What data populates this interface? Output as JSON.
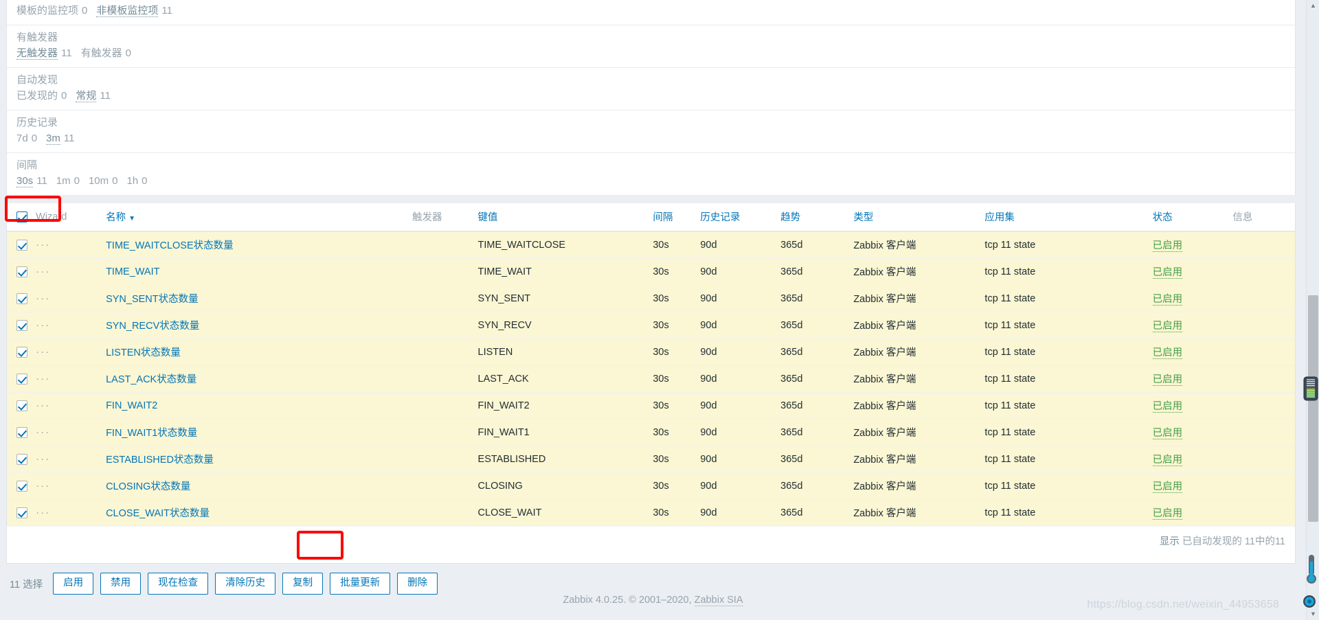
{
  "summary": [
    {
      "name": "template-items",
      "title": null,
      "values": [
        {
          "label": "模板的监控项",
          "count": "0",
          "link": false
        },
        {
          "label": "非模板监控项",
          "count": "11",
          "link": true
        }
      ]
    },
    {
      "name": "triggers",
      "title": "有触发器",
      "values": [
        {
          "label": "无触发器",
          "count": "11",
          "link": true
        },
        {
          "label": "有触发器",
          "count": "0",
          "link": false
        }
      ]
    },
    {
      "name": "discovery",
      "title": "自动发现",
      "values": [
        {
          "label": "已发现的",
          "count": "0",
          "link": false
        },
        {
          "label": "常规",
          "count": "11",
          "link": true
        }
      ]
    },
    {
      "name": "history",
      "title": "历史记录",
      "values": [
        {
          "label": "7d",
          "count": "0",
          "link": false
        },
        {
          "label": "3m",
          "count": "11",
          "link": true
        }
      ]
    },
    {
      "name": "interval",
      "title": "间隔",
      "values": [
        {
          "label": "30s",
          "count": "11",
          "link": true
        },
        {
          "label": "1m",
          "count": "0",
          "link": false
        },
        {
          "label": "10m",
          "count": "0",
          "link": false
        },
        {
          "label": "1h",
          "count": "0",
          "link": false
        }
      ]
    }
  ],
  "table": {
    "headers": {
      "wizard": "Wizard",
      "name": "名称",
      "sort_indicator": "▼",
      "triggers": "触发器",
      "key": "键值",
      "interval": "间隔",
      "history": "历史记录",
      "trends": "趋势",
      "type": "类型",
      "applications": "应用集",
      "status": "状态",
      "info": "信息"
    },
    "row_menu_icon": "···",
    "rows": [
      {
        "name": "TIME_WAITCLOSE状态数量",
        "triggers": "",
        "key": "TIME_WAITCLOSE",
        "interval": "30s",
        "history": "90d",
        "trends": "365d",
        "type": "Zabbix 客户端",
        "applications": "tcp 11 state",
        "status": "已启用",
        "info": ""
      },
      {
        "name": "TIME_WAIT",
        "triggers": "",
        "key": "TIME_WAIT",
        "interval": "30s",
        "history": "90d",
        "trends": "365d",
        "type": "Zabbix 客户端",
        "applications": "tcp 11 state",
        "status": "已启用",
        "info": ""
      },
      {
        "name": "SYN_SENT状态数量",
        "triggers": "",
        "key": "SYN_SENT",
        "interval": "30s",
        "history": "90d",
        "trends": "365d",
        "type": "Zabbix 客户端",
        "applications": "tcp 11 state",
        "status": "已启用",
        "info": ""
      },
      {
        "name": "SYN_RECV状态数量",
        "triggers": "",
        "key": "SYN_RECV",
        "interval": "30s",
        "history": "90d",
        "trends": "365d",
        "type": "Zabbix 客户端",
        "applications": "tcp 11 state",
        "status": "已启用",
        "info": ""
      },
      {
        "name": "LISTEN状态数量",
        "triggers": "",
        "key": "LISTEN",
        "interval": "30s",
        "history": "90d",
        "trends": "365d",
        "type": "Zabbix 客户端",
        "applications": "tcp 11 state",
        "status": "已启用",
        "info": ""
      },
      {
        "name": "LAST_ACK状态数量",
        "triggers": "",
        "key": "LAST_ACK",
        "interval": "30s",
        "history": "90d",
        "trends": "365d",
        "type": "Zabbix 客户端",
        "applications": "tcp 11 state",
        "status": "已启用",
        "info": ""
      },
      {
        "name": "FIN_WAIT2",
        "triggers": "",
        "key": "FIN_WAIT2",
        "interval": "30s",
        "history": "90d",
        "trends": "365d",
        "type": "Zabbix 客户端",
        "applications": "tcp 11 state",
        "status": "已启用",
        "info": ""
      },
      {
        "name": "FIN_WAIT1状态数量",
        "triggers": "",
        "key": "FIN_WAIT1",
        "interval": "30s",
        "history": "90d",
        "trends": "365d",
        "type": "Zabbix 客户端",
        "applications": "tcp 11 state",
        "status": "已启用",
        "info": ""
      },
      {
        "name": "ESTABLISHED状态数量",
        "triggers": "",
        "key": "ESTABLISHED",
        "interval": "30s",
        "history": "90d",
        "trends": "365d",
        "type": "Zabbix 客户端",
        "applications": "tcp 11 state",
        "status": "已启用",
        "info": ""
      },
      {
        "name": "CLOSING状态数量",
        "triggers": "",
        "key": "CLOSING",
        "interval": "30s",
        "history": "90d",
        "trends": "365d",
        "type": "Zabbix 客户端",
        "applications": "tcp 11 state",
        "status": "已启用",
        "info": ""
      },
      {
        "name": "CLOSE_WAIT状态数量",
        "triggers": "",
        "key": "CLOSE_WAIT",
        "interval": "30s",
        "history": "90d",
        "trends": "365d",
        "type": "Zabbix 客户端",
        "applications": "tcp 11 state",
        "status": "已启用",
        "info": ""
      }
    ],
    "footer": {
      "showing_label": "显示",
      "showing_scope": "已自动发现的",
      "showing_count": "11中的11"
    }
  },
  "actionbar": {
    "selected_label": "11 选择",
    "buttons": [
      {
        "name": "enable",
        "label": "启用"
      },
      {
        "name": "disable",
        "label": "禁用"
      },
      {
        "name": "check-now",
        "label": "现在检查"
      },
      {
        "name": "clear-history",
        "label": "清除历史"
      },
      {
        "name": "copy",
        "label": "复制"
      },
      {
        "name": "mass-update",
        "label": "批量更新"
      },
      {
        "name": "delete",
        "label": "删除"
      }
    ]
  },
  "footer": {
    "text": "Zabbix 4.0.25. © 2001–2020, ",
    "link": "Zabbix SIA"
  },
  "watermark": "https://blog.csdn.net/weixin_44953658",
  "scrollbar": {
    "up_arrow": "▲",
    "down_arrow": "▼"
  },
  "colors": {
    "accent": "#0275b8",
    "status_enabled": "#429e47",
    "selected_row": "#fbf6d3",
    "highlight": "#ff0000",
    "page_bg": "#ebeef2",
    "muted_text": "#97a4ae"
  }
}
